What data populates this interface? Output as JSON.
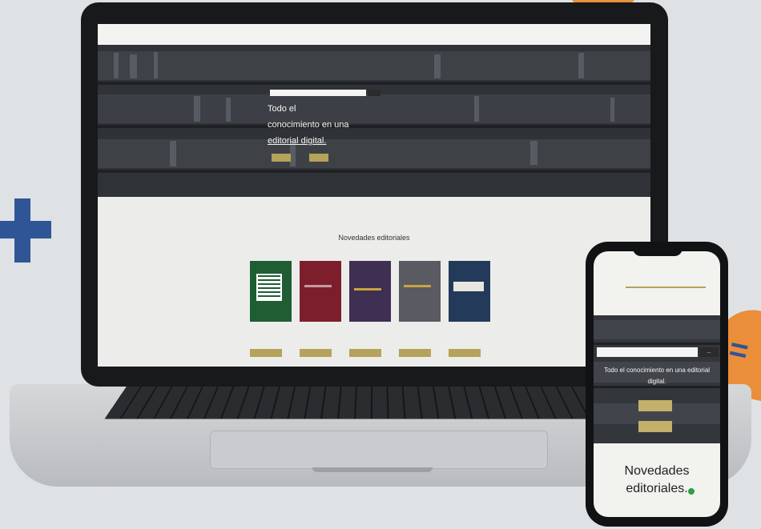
{
  "decor": {
    "plus_icon": "plus-icon",
    "equals_icon": "equals-icon",
    "accent_blue": "#2f5597",
    "accent_orange": "#ea8e3a"
  },
  "laptop": {
    "header": {
      "logo": "",
      "nav": [
        "",
        "",
        "",
        "",
        "",
        ""
      ],
      "top_line": ""
    },
    "hero": {
      "search_placeholder": "",
      "heading_lines": [
        "Todo el",
        "conocimiento en una",
        "editorial digital."
      ],
      "button_labels": [
        "",
        ""
      ]
    },
    "books": {
      "title": "Novedades editoriales",
      "items": [
        {
          "cover_color": "#1f5d33",
          "caption": "",
          "button": ""
        },
        {
          "cover_color": "#7d1e2d",
          "caption": "",
          "button": ""
        },
        {
          "cover_color": "#3f2f52",
          "caption": "",
          "button": ""
        },
        {
          "cover_color": "#5a5a62",
          "caption": "",
          "button": ""
        },
        {
          "cover_color": "#233a5a",
          "caption": "",
          "button": ""
        }
      ]
    },
    "accent_gold": "#b5a25b"
  },
  "phone": {
    "top_line": "",
    "logo_text": "",
    "search_placeholder": "",
    "search_button": "...",
    "heading": "Todo el conocimiento en una editorial digital.",
    "buttons": [
      "",
      ""
    ],
    "section_title": "Novedades editoriales."
  }
}
